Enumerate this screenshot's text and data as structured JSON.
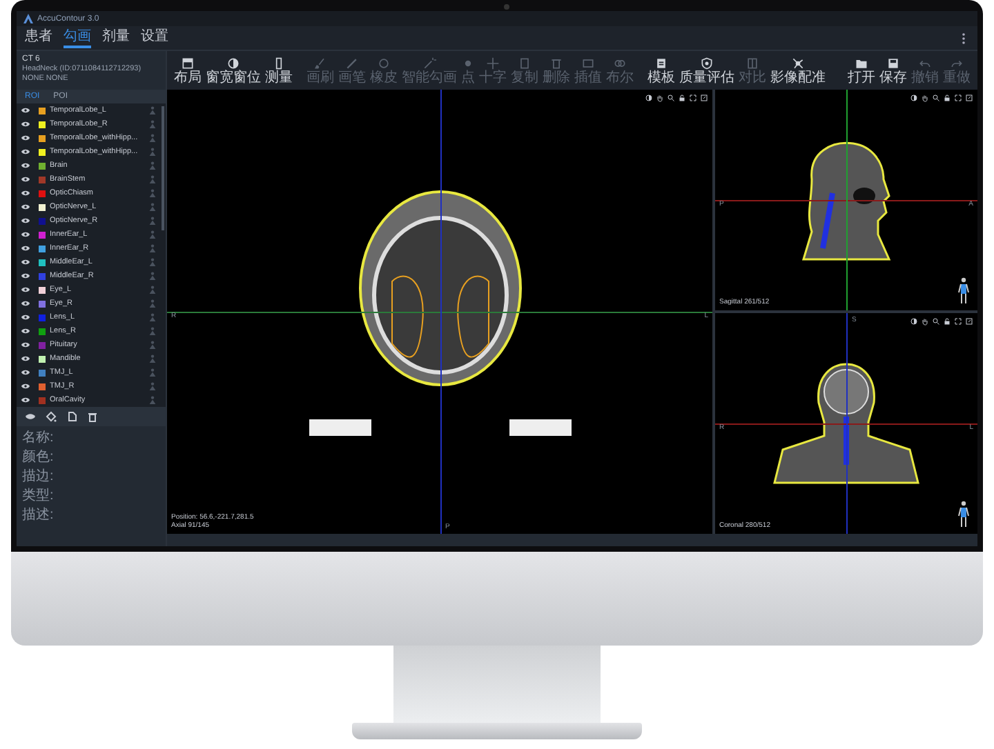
{
  "app": {
    "title": "AccuContour 3.0"
  },
  "menu_tabs": [
    {
      "label": "患者",
      "selected": false
    },
    {
      "label": "勾画",
      "selected": true
    },
    {
      "label": "剂量",
      "selected": false
    },
    {
      "label": "设置",
      "selected": false
    }
  ],
  "image_info": {
    "modality": "CT 6",
    "series": "HeadNeck (ID:0711084112712293)",
    "status": "NONE  NONE"
  },
  "toolbar": [
    {
      "items": [
        {
          "label": "布局",
          "disabled": false
        },
        {
          "label": "窗宽窗位",
          "disabled": false
        },
        {
          "label": "测量",
          "disabled": false
        }
      ]
    },
    {
      "items": [
        {
          "label": "画刷",
          "disabled": true
        },
        {
          "label": "画笔",
          "disabled": true
        },
        {
          "label": "橡皮",
          "disabled": true
        },
        {
          "label": "智能勾画",
          "disabled": true
        },
        {
          "label": "点",
          "disabled": true
        },
        {
          "label": "十字",
          "disabled": true
        },
        {
          "label": "复制",
          "disabled": true
        },
        {
          "label": "删除",
          "disabled": true
        },
        {
          "label": "插值",
          "disabled": true
        },
        {
          "label": "布尔",
          "disabled": true
        }
      ]
    },
    {
      "items": [
        {
          "label": "模板",
          "disabled": false
        },
        {
          "label": "质量评估",
          "disabled": false
        },
        {
          "label": "对比",
          "disabled": true
        },
        {
          "label": "影像配准",
          "disabled": false
        }
      ]
    },
    {
      "items": [
        {
          "label": "打开",
          "disabled": false
        },
        {
          "label": "保存",
          "disabled": false
        },
        {
          "label": "撤销",
          "disabled": true
        },
        {
          "label": "重做",
          "disabled": true
        }
      ]
    }
  ],
  "roi_tabs": [
    {
      "label": "ROI",
      "selected": true
    },
    {
      "label": "POI",
      "selected": false
    }
  ],
  "rois": [
    {
      "name": "TemporalLobe_L",
      "color": "#e8a020",
      "visible": true
    },
    {
      "name": "TemporalLobe_R",
      "color": "#f0f020",
      "visible": true
    },
    {
      "name": "TemporalLobe_withHipp...",
      "color": "#e8a020",
      "visible": true
    },
    {
      "name": "TemporalLobe_withHipp...",
      "color": "#f0f020",
      "visible": true
    },
    {
      "name": "Brain",
      "color": "#70b030",
      "visible": true
    },
    {
      "name": "BrainStem",
      "color": "#a03828",
      "visible": true
    },
    {
      "name": "OpticChiasm",
      "color": "#e01010",
      "visible": true
    },
    {
      "name": "OpticNerve_L",
      "color": "#f0f0d0",
      "visible": true
    },
    {
      "name": "OpticNerve_R",
      "color": "#101090",
      "visible": true
    },
    {
      "name": "InnerEar_L",
      "color": "#d020d0",
      "visible": true
    },
    {
      "name": "InnerEar_R",
      "color": "#40a0e0",
      "visible": true
    },
    {
      "name": "MiddleEar_L",
      "color": "#20c0c0",
      "visible": true
    },
    {
      "name": "MiddleEar_R",
      "color": "#3040e0",
      "visible": true
    },
    {
      "name": "Eye_L",
      "color": "#f0d0d8",
      "visible": true
    },
    {
      "name": "Eye_R",
      "color": "#8070e0",
      "visible": true
    },
    {
      "name": "Lens_L",
      "color": "#1020e0",
      "visible": true
    },
    {
      "name": "Lens_R",
      "color": "#10a010",
      "visible": true
    },
    {
      "name": "Pituitary",
      "color": "#8020a0",
      "visible": true
    },
    {
      "name": "Mandible",
      "color": "#c0f0b0",
      "visible": true
    },
    {
      "name": "TMJ_L",
      "color": "#4080c0",
      "visible": true
    },
    {
      "name": "TMJ_R",
      "color": "#e06030",
      "visible": true
    },
    {
      "name": "OralCavity",
      "color": "#a03020",
      "visible": true
    }
  ],
  "properties": [
    "名称:",
    "颜色:",
    "描边:",
    "类型:",
    "描述:"
  ],
  "views": [
    {
      "kind": "axial",
      "caption": [
        "Position: 56.6,-221.7,281.5",
        "Axial 91/145"
      ],
      "orientation": {
        "left": "R",
        "right": "L",
        "bottom": "P"
      }
    },
    {
      "kind": "sagittal",
      "caption": [
        "Sagittal 261/512"
      ],
      "orientation": {
        "left": "P",
        "right": "A"
      }
    },
    {
      "kind": "coronal",
      "caption": [
        "Coronal 280/512"
      ],
      "orientation": {
        "top": "S",
        "left": "R",
        "right": "L"
      }
    }
  ]
}
